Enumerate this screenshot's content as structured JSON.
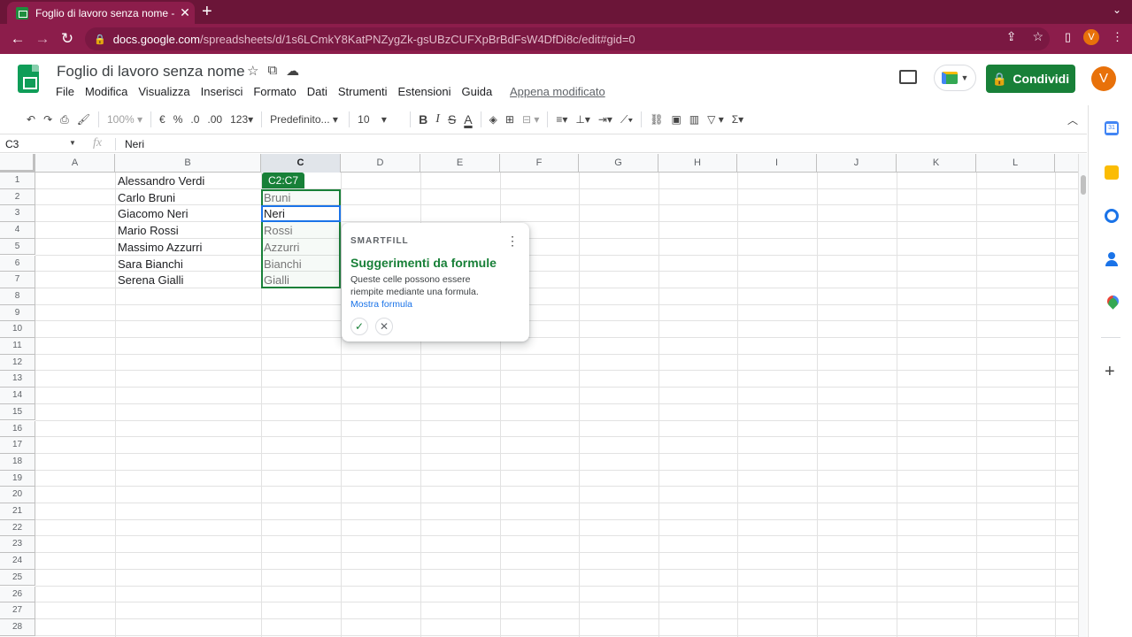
{
  "browser": {
    "tab_title": "Foglio di lavoro senza nome - F",
    "tab_close": "✕",
    "new_tab": "+",
    "url_host": "docs.google.com",
    "url_path": "/spreadsheets/d/1s6LCmkY8KatPNZygZk-gsUBzCUFXpBrBdFsW4DfDi8c/edit#gid=0",
    "profile_initial": "V"
  },
  "doc": {
    "title": "Foglio di lavoro senza nome",
    "menu": [
      "File",
      "Modifica",
      "Visualizza",
      "Inserisci",
      "Formato",
      "Dati",
      "Strumenti",
      "Estensioni",
      "Guida"
    ],
    "last_edit": "Appena modificato",
    "share_label": "Condividi",
    "avatar_initial": "V"
  },
  "toolbar": {
    "zoom": "100%",
    "currency": "€",
    "percent": "%",
    "dec_less": ".0",
    "dec_more": ".00",
    "more_formats": "123",
    "font": "Predefinito...",
    "font_size": "10",
    "bold": "B",
    "italic": "I",
    "strike": "S",
    "text_color": "A"
  },
  "formula_bar": {
    "name_box": "C3",
    "fx": "fx",
    "value": "Neri"
  },
  "grid": {
    "columns": [
      "A",
      "B",
      "C",
      "D",
      "E",
      "F",
      "G",
      "H",
      "I",
      "J",
      "K",
      "L"
    ],
    "active_column": "C",
    "rows": [
      "1",
      "2",
      "3",
      "4",
      "5",
      "6",
      "7",
      "8",
      "9",
      "10",
      "11",
      "12",
      "13",
      "14",
      "15",
      "16",
      "17",
      "18",
      "19",
      "20",
      "21",
      "22",
      "23",
      "24",
      "25",
      "26",
      "27",
      "28"
    ],
    "column_b": [
      "Alessandro Verdi",
      "Carlo Bruni",
      "Giacomo Neri",
      "Mario Rossi",
      "Massimo Azzurri",
      "Sara Bianchi",
      "Serena Gialli"
    ],
    "column_c": [
      "",
      "Bruni",
      "Neri",
      "Rossi",
      "Azzurri",
      "Bianchi",
      "Gialli"
    ],
    "range_label": "C2:C7"
  },
  "smartfill": {
    "label": "SMARTFILL",
    "title": "Suggerimenti da formule",
    "description": "Queste celle possono essere riempite mediante una formula.",
    "link": "Mostra formula",
    "accept": "✓",
    "reject": "✕"
  },
  "colors": {
    "chrome": "#8c1d4b",
    "accent_green": "#188038",
    "selection_blue": "#1a73e8"
  }
}
